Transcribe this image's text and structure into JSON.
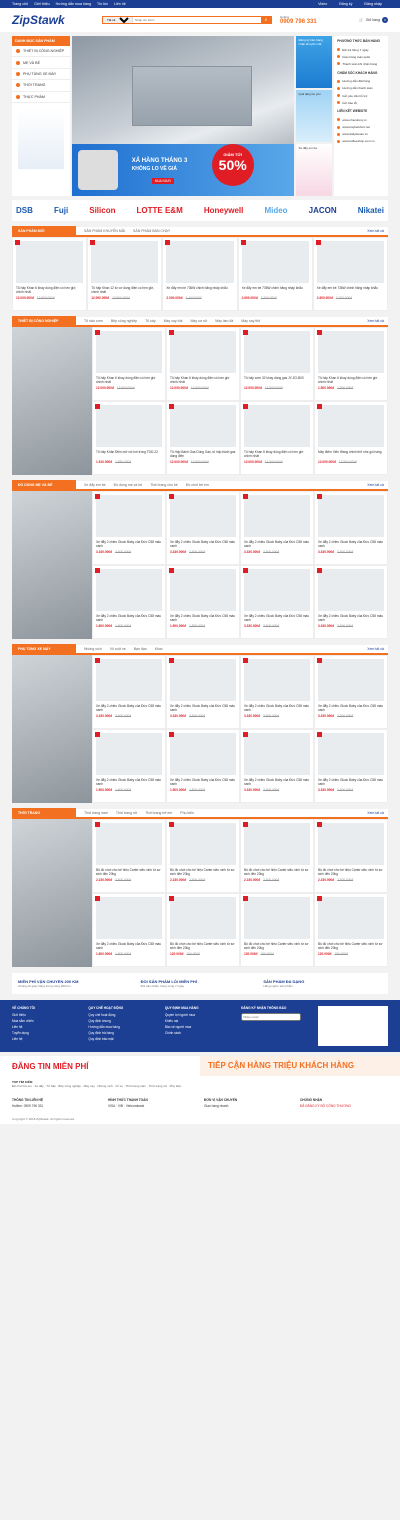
{
  "topbar": {
    "links": [
      "Trang chủ",
      "Giới thiệu",
      "Hướng dẫn mua hàng",
      "Tin tức",
      "Liên hệ"
    ],
    "right": [
      "Video",
      "Đăng ký",
      "Đăng nhập"
    ]
  },
  "header": {
    "logo": "ZipStawk",
    "search_cat": "Tất cả danh mục",
    "search_placeholder": "Nhập tìm kiếm",
    "hotline_label": "Hotline",
    "hotline": "0909 796 331",
    "cart_label": "Giỏ hàng",
    "cart_count": "0"
  },
  "categories": {
    "title": "DANH MỤC SẢN PHẨM",
    "items": [
      "THIẾT BỊ CÔNG NGHIỆP",
      "MẸ VÀ BÉ",
      "PHỤ TÙNG XE MÁY",
      "THỜI TRANG",
      "THỰC PHẨM"
    ]
  },
  "banner": {
    "line1": "XẢ HÀNG THÁNG 3",
    "line2": "KHÔNG LO VỀ GIÁ",
    "discount_label": "GIẢM TỚI",
    "discount": "50%",
    "buy": "MUA NGAY"
  },
  "minis": [
    "Đăng ký bán hàng nhận khuyến mãi",
    "Quà tặng bé yêu",
    "Xe đẩy em bé"
  ],
  "side": {
    "h1": "PHƯƠNG THỨC BÁN HÀNG",
    "a": [
      "Đổi trả hàng 7 ngày",
      "Giao hàng toàn quốc",
      "Thanh toán khi nhận hàng"
    ],
    "h2": "CHĂM SÓC KHÁCH HÀNG",
    "b": [
      "Hướng dẫn đặt hàng",
      "Hướng dẫn thanh toán",
      "Gửi yêu cầu hỗ trợ",
      "Gửi báo lỗi"
    ],
    "h3": "LIÊN KẾT WEBSITE",
    "c": [
      "www.nhacdonq.vn",
      "www.baybelshort.net",
      "www.dailyduoan.vn",
      "www.koffeeshop.com.vn"
    ]
  },
  "brands": [
    "DSB",
    "Fuji",
    "Silicon",
    "LOTTE E&M",
    "Honeywell",
    "Mideo",
    "JACON",
    "Nikatei"
  ],
  "sections": [
    {
      "title": "SẢN PHẨM MỚI",
      "tabs": [
        "SẢN PHẨM KHUYẾN MÃI",
        "SẢN PHẨM BÁN CHẠY"
      ],
      "more": "Xem tất cả",
      "products": [
        {
          "name": "Tủ hấp Khan 6 khay dùng điện có hen giờ, chính nhất",
          "price": "12.000.000đ",
          "old": "13.500.000đ"
        },
        {
          "name": "Tủ hấp Khan 12 từ cơ dùng điện có hen giờ, chính nhất",
          "price": "12.000.000đ",
          "old": "13.500.000đ"
        },
        {
          "name": "Xe đẩy em bé 736W chinh hãng nhập khẩu",
          "price": "2.000.000đ",
          "old": "2.400.000đ"
        },
        {
          "name": "Xe đẩy em bé 736W chinh hãng nhập khẩu",
          "price": "2.600.000đ",
          "old": "3.200.000đ"
        },
        {
          "name": "Xe đẩy em bé 736W chinh hãng nhập khẩu",
          "price": "2.600.000đ",
          "old": "3.200.000đ"
        }
      ]
    },
    {
      "title": "THIẾT BỊ CÔNG NGHIỆP",
      "tabs": [
        "Tủ nấu cơm",
        "Bếp công nghiệp",
        "Tủ sấy",
        "Máy xay bột",
        "Máy sơ sử",
        "Máy làm đá",
        "Máy xay thịt"
      ],
      "more": "Xem tất cả",
      "products": [
        {
          "name": "Tủ hấp Khan 6 khay dùng điện có hen giờ chính nhất",
          "price": "12.000.000đ",
          "old": "13.500.000đ"
        },
        {
          "name": "Tủ hấp Khan 6 khay dùng điện có hen giờ chính nhất",
          "price": "12.000.000đ",
          "old": "13.500.000đ"
        },
        {
          "name": "Tủ hấp cơm 32 khay dùng gas JY-ZG-B00",
          "price": "12.000.000đ",
          "old": "13.500.000đ"
        },
        {
          "name": "Tủ hấp Khan 6 khay dùng điện có hen giờ chính nhất",
          "price": "1.500.000đ",
          "old": "1.800.000đ"
        },
        {
          "name": "Tủ hấp Khăn Điện mở vòi hơi trong TDD-22",
          "price": "1.510.000đ",
          "old": "1.850.000đ"
        },
        {
          "name": "Tủ Hấp Bánh Gas Dùng Gas, tủ hấp bánh gas dùng điện",
          "price": "12.000.000đ",
          "old": "13.500.000đ"
        },
        {
          "name": "Tủ hấp Khan 6 khay dùng điện có hen giờ chính nhất",
          "price": "12.000.000đ",
          "old": "13.500.000đ"
        },
        {
          "name": "Máy điêm Viên Wang chinh thở nhẹ gói hàng",
          "price": "12.000.000đ",
          "old": "13.500.000đ"
        }
      ]
    },
    {
      "title": "ĐỒ DÙNG MẸ VÀ BÉ",
      "tabs": [
        "Xe đẩy em bé",
        "Đồ dùng mẹ và bé",
        "Thời trang cho bé",
        "Đồ chơi trẻ em"
      ],
      "more": "Xem tất cả",
      "products": [
        {
          "name": "Xe đẩy 2 chiều Gluck Baby của Đức C58 màu xanh",
          "price": "3.330.000đ",
          "old": "3.500.000đ"
        },
        {
          "name": "Xe đẩy 2 chiều Gluck Baby của Đức C58 màu xanh",
          "price": "3.330.000đ",
          "old": "3.500.000đ"
        },
        {
          "name": "Xe đẩy 2 chiều Gluck Baby của Đức C58 màu xanh",
          "price": "3.330.000đ",
          "old": "3.500.000đ"
        },
        {
          "name": "Xe đẩy 2 chiều Gluck Baby của Đức C58 màu xanh",
          "price": "3.330.000đ",
          "old": "3.500.000đ"
        },
        {
          "name": "Xe đẩy 2 chiều Gluck Baby của Đức C58 màu xanh",
          "price": "1.500.000đ",
          "old": "1.800.000đ"
        },
        {
          "name": "Xe đẩy 2 chiều Gluck Baby của Đức C58 màu xanh",
          "price": "1.500.000đ",
          "old": "1.800.000đ"
        },
        {
          "name": "Xe đẩy 2 chiều Gluck Baby của Đức C58 màu xanh",
          "price": "3.330.000đ",
          "old": "3.500.000đ"
        },
        {
          "name": "Xe đẩy 2 chiều Gluck Baby của Đức C58 màu xanh",
          "price": "3.330.000đ",
          "old": "3.500.000đ"
        }
      ]
    },
    {
      "title": "PHỤ TÙNG XE MÁY",
      "tabs": [
        "Nhông xích",
        "Vỏ ruột xe",
        "Bạn đạn",
        "Khác"
      ],
      "more": "Xem tất cả",
      "products": [
        {
          "name": "Xe đẩy 2 chiều Gluck Baby của Đức C58 màu xanh",
          "price": "3.330.000đ",
          "old": "3.500.000đ"
        },
        {
          "name": "Xe đẩy 2 chiều Gluck Baby của Đức C58 màu xanh",
          "price": "3.330.000đ",
          "old": "3.500.000đ"
        },
        {
          "name": "Xe đẩy 2 chiều Gluck Baby của Đức C58 màu xanh",
          "price": "3.330.000đ",
          "old": "3.500.000đ"
        },
        {
          "name": "Xe đẩy 2 chiều Gluck Baby của Đức C58 màu xanh",
          "price": "3.330.000đ",
          "old": "3.500.000đ"
        },
        {
          "name": "Xe đẩy 2 chiều Gluck Baby của Đức C58 màu xanh",
          "price": "1.500.000đ",
          "old": "1.800.000đ"
        },
        {
          "name": "Xe đẩy 2 chiều Gluck Baby của Đức C58 màu xanh",
          "price": "1.500.000đ",
          "old": "1.800.000đ"
        },
        {
          "name": "Xe đẩy 2 chiều Gluck Baby của Đức C58 màu xanh",
          "price": "3.330.000đ",
          "old": "3.500.000đ"
        },
        {
          "name": "Xe đẩy 2 chiều Gluck Baby của Đức C58 màu xanh",
          "price": "3.330.000đ",
          "old": "3.500.000đ"
        }
      ]
    },
    {
      "title": "THỜI TRANG",
      "tabs": [
        "Thời trang nam",
        "Thời trang nữ",
        "Thời trang trẻ em",
        "Phụ kiện"
      ],
      "more": "Xem tất cả",
      "products": [
        {
          "name": "Bộ đồ chơi cho bé hiệu Carter siêu xinh từ sơ sinh đến 20kg",
          "price": "2.230.000đ",
          "old": "2.500.000đ"
        },
        {
          "name": "Bộ đồ chơi cho bé hiệu Carter siêu xinh từ sơ sinh đến 20kg",
          "price": "2.230.000đ",
          "old": "2.500.000đ"
        },
        {
          "name": "Bộ đồ chơi cho bé hiệu Carter siêu xinh từ sơ sinh đến 20kg",
          "price": "2.230.000đ",
          "old": "2.500.000đ"
        },
        {
          "name": "Bộ đồ chơi cho bé hiệu Carter siêu xinh từ sơ sinh đến 20kg",
          "price": "2.230.000đ",
          "old": "2.500.000đ"
        },
        {
          "name": "Xe đẩy 2 chiều Gluck Baby của Đức C58 màu xanh",
          "price": "1.500.000đ",
          "old": "1.800.000đ"
        },
        {
          "name": "Bộ đồ chơi cho bé hiệu Carter siêu xinh từ sơ sinh đến 20kg",
          "price": "120.000đ",
          "old": "150.000đ"
        },
        {
          "name": "Bộ đồ chơi cho bé hiệu Carter siêu xinh từ sơ sinh đến 20kg",
          "price": "120.000đ",
          "old": "150.000đ"
        },
        {
          "name": "Bộ đồ chơi cho bé hiệu Carter siêu xinh từ sơ sinh đến 20kg",
          "price": "120.000đ",
          "old": "150.000đ"
        }
      ]
    }
  ],
  "features": [
    {
      "t": "MIỄN PHÍ VẬN CHUYỂN 200 KM",
      "s": "Chúng tôi giao hàng trong vòng 200 km"
    },
    {
      "t": "ĐỔI SẢN PHẨM LỖI MIỄN PHÍ",
      "s": "Đổi sản phẩm trong vòng 7 ngày"
    },
    {
      "t": "SẢN PHẨM ĐA DẠNG",
      "s": "Hàng nghìn sản phẩm"
    }
  ],
  "footer": {
    "cols": [
      {
        "t": "VỀ CHÚNG TÔI",
        "items": [
          "Giới thiệu",
          "Mua sắm chiến",
          "Liên hệ",
          "Tuyển dụng",
          "Liên hệ"
        ]
      },
      {
        "t": "QUY CHẾ HOẠT ĐỘNG",
        "items": [
          "Quy chế hoạt động",
          "Quy định chung",
          "Hướng dẫn mua hàng",
          "Quy định trả hàng",
          "Quy định bảo mật"
        ]
      },
      {
        "t": "QUY ĐỊNH MUA HÀNG",
        "items": [
          "Quyền lợi người mua",
          "Khiếu nại",
          "Bảo vệ người mua",
          "Chính sách"
        ]
      },
      {
        "t": "ĐĂNG KÝ NHẬN THÔNG BÁO",
        "items": [
          "Nhập email"
        ]
      }
    ]
  },
  "promo": {
    "left": "ĐĂNG TIN MIỄN PHÍ",
    "right": "TIẾP CẬN HÀNG TRIỆU KHÁCH HÀNG"
  },
  "tags": {
    "title": "TOP TÌM KIẾM",
    "text": "Đồ chơi trẻ em · Xe đẩy · Tủ hấp · Bếp công nghiệp · Máy xay · Nhông xích · Vỏ xe · Thời trang nam · Thời trang nữ · Phụ kiện"
  },
  "bottom": [
    {
      "t": "THÔNG TIN LIÊN HỆ",
      "s": "Hotline: 0909 796 331"
    },
    {
      "t": "HÌNH THỨC THANH TOÁN",
      "s": "VISA · VIB · Vietcombank"
    },
    {
      "t": "ĐƠN VỊ VẬN CHUYỂN",
      "s": "Giao hàng nhanh"
    },
    {
      "t": "CHỨNG NHẬN",
      "s": "ĐÃ ĐĂNG KÝ BỘ CÔNG THƯƠNG"
    }
  ],
  "copyright": "Copyright © 2018 ZipStawk. All rights reserved."
}
